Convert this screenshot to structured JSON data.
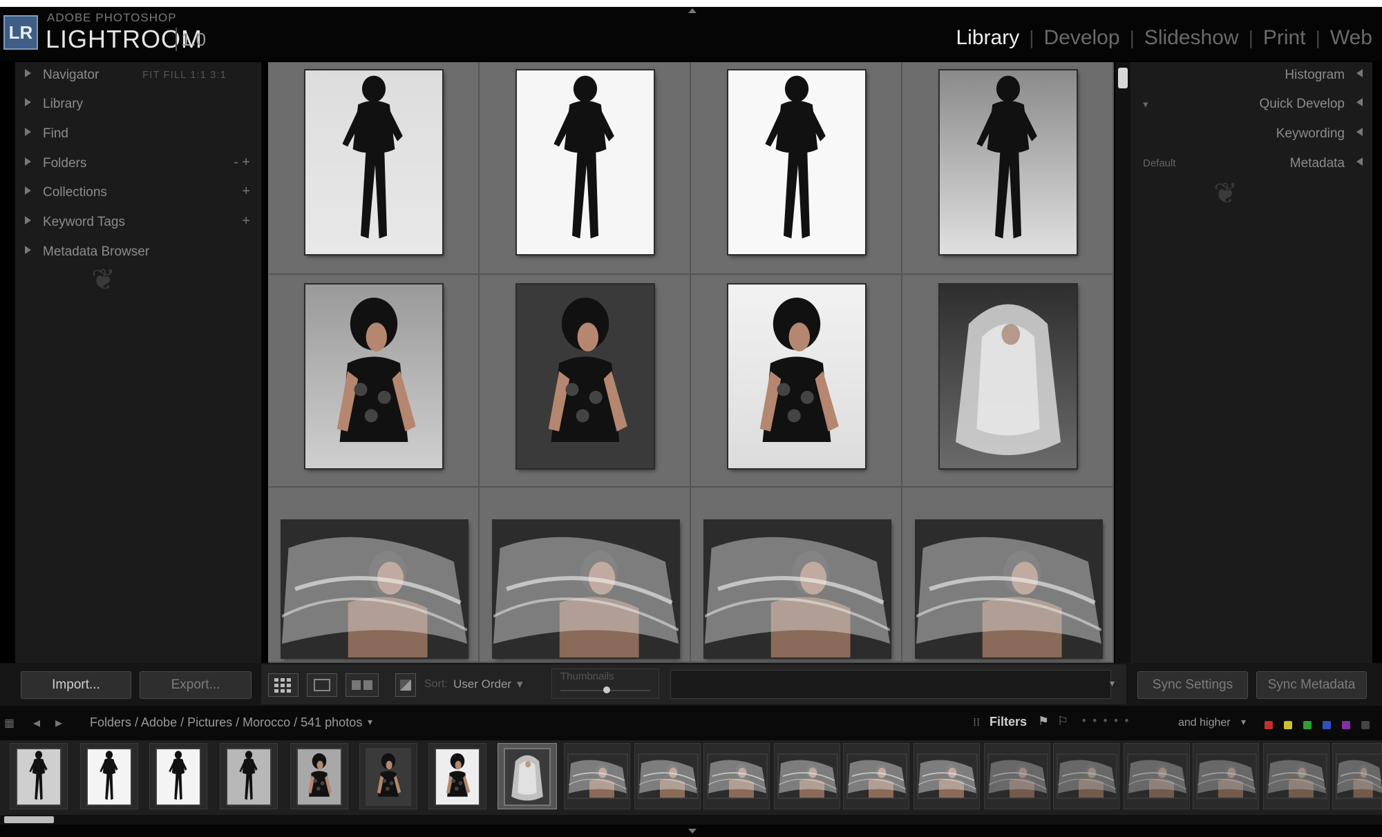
{
  "app": {
    "logo": "LR",
    "brand_sub": "ADOBE PHOTOSHOP",
    "brand_main": "LIGHTROOM",
    "version": "1.0"
  },
  "modules": [
    "Library",
    "Develop",
    "Slideshow",
    "Print",
    "Web"
  ],
  "active_module": "Library",
  "left_panel": {
    "navigator": {
      "label": "Navigator",
      "zoom": "FIT FILL 1:1 3:1"
    },
    "sections": [
      {
        "label": "Library"
      },
      {
        "label": "Find"
      },
      {
        "label": "Folders",
        "extra": "- +"
      },
      {
        "label": "Collections",
        "extra": "+"
      },
      {
        "label": "Keyword Tags",
        "extra": "+"
      },
      {
        "label": "Metadata Browser"
      }
    ]
  },
  "right_panel": {
    "sections": [
      {
        "label": "Histogram"
      },
      {
        "label": "Quick Develop"
      },
      {
        "label": "Keywording"
      },
      {
        "label": "Metadata"
      }
    ],
    "metadata_preset": "Default",
    "sync_settings": "Sync Settings",
    "sync_metadata": "Sync Metadata"
  },
  "buttons": {
    "import": "Import...",
    "export": "Export..."
  },
  "toolbar": {
    "sort_label": "Sort:",
    "sort_value": "User Order",
    "thumbnails_label": "Thumbnails"
  },
  "filmstrip_bar": {
    "breadcrumb": "Folders / Adobe / Pictures / Morocco / 541 photos",
    "filters_label": "Filters",
    "rating_filter": "and higher"
  },
  "colors": {
    "accent_logo": "#3e5e86",
    "label_red": "#c03030",
    "label_yellow": "#c8c030",
    "label_green": "#30a030",
    "label_blue": "#3050c0",
    "label_purple": "#8030a0"
  }
}
